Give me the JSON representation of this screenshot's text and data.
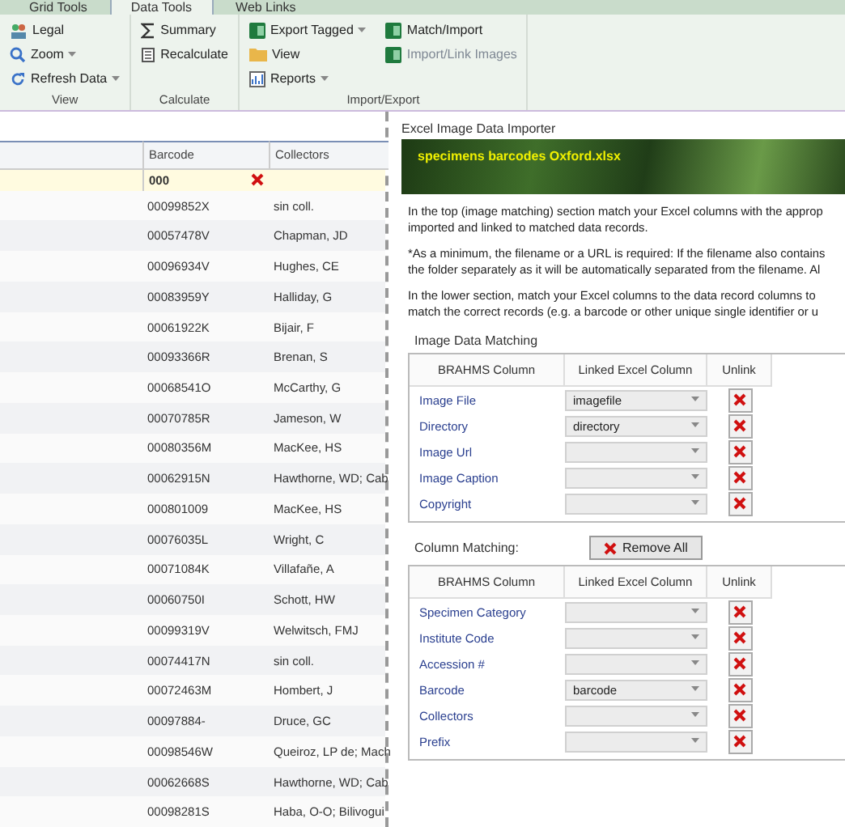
{
  "ribbon": {
    "tabs": [
      {
        "label": "Grid Tools",
        "selected": false
      },
      {
        "label": "Data Tools",
        "selected": true
      },
      {
        "label": "Web Links",
        "selected": false
      }
    ],
    "groups": [
      {
        "label": "View",
        "items": [
          {
            "label": "Legal",
            "has_menu": false,
            "disabled": false
          },
          {
            "label": "Zoom",
            "has_menu": true,
            "disabled": false
          },
          {
            "label": "Refresh Data",
            "has_menu": true,
            "disabled": false
          }
        ]
      },
      {
        "label": "Calculate",
        "items": [
          {
            "label": "Summary",
            "has_menu": false,
            "disabled": false
          },
          {
            "label": "Recalculate",
            "has_menu": false,
            "disabled": false
          }
        ]
      },
      {
        "label": "Import/Export",
        "items": [
          {
            "label": "Export Tagged",
            "has_menu": true,
            "disabled": false
          },
          {
            "label": "View",
            "has_menu": false,
            "disabled": false
          },
          {
            "label": "Reports",
            "has_menu": true,
            "disabled": false
          },
          {
            "label": "Match/Import",
            "has_menu": false,
            "disabled": false
          },
          {
            "label": "Import/Link Images",
            "has_menu": false,
            "disabled": true
          }
        ]
      }
    ]
  },
  "grid": {
    "columns": [
      "Barcode",
      "Collectors"
    ],
    "filter": "000",
    "rows": [
      {
        "barcode": "00099852X",
        "collectors": "sin coll."
      },
      {
        "barcode": "00057478V",
        "collectors": "Chapman, JD"
      },
      {
        "barcode": "00096934V",
        "collectors": "Hughes, CE"
      },
      {
        "barcode": "00083959Y",
        "collectors": "Halliday, G"
      },
      {
        "barcode": "00061922K",
        "collectors": "Bijair, F"
      },
      {
        "barcode": "00093366R",
        "collectors": "Brenan, S"
      },
      {
        "barcode": "00068541O",
        "collectors": "McCarthy, G"
      },
      {
        "barcode": "00070785R",
        "collectors": "Jameson, W"
      },
      {
        "barcode": "00080356M",
        "collectors": "MacKee, HS"
      },
      {
        "barcode": "00062915N",
        "collectors": "Hawthorne, WD; Cab"
      },
      {
        "barcode": "000801009",
        "collectors": "MacKee, HS"
      },
      {
        "barcode": "00076035L",
        "collectors": "Wright, C"
      },
      {
        "barcode": "00071084K",
        "collectors": "Villafañe, A"
      },
      {
        "barcode": "00060750I",
        "collectors": "Schott, HW"
      },
      {
        "barcode": "00099319V",
        "collectors": "Welwitsch, FMJ"
      },
      {
        "barcode": "00074417N",
        "collectors": "sin coll."
      },
      {
        "barcode": "00072463M",
        "collectors": "Hombert, J"
      },
      {
        "barcode": "00097884-",
        "collectors": "Druce, GC"
      },
      {
        "barcode": "00098546W",
        "collectors": "Queiroz, LP de; Mach"
      },
      {
        "barcode": "00062668S",
        "collectors": "Hawthorne, WD; Cab"
      },
      {
        "barcode": "00098281S",
        "collectors": "Haba, O-O; Bilivogui"
      }
    ]
  },
  "importer": {
    "title": "Excel Image Data Importer",
    "file": "specimens barcodes Oxford.xlsx",
    "paragraphs": [
      "In the top (image matching) section match your Excel columns with the approp imported and linked to matched data records.",
      "*As a minimum, the filename or a URL is required: If the filename also contains the folder separately as it will be automatically separated from the filename. Al",
      "In the lower section, match your Excel columns to the data record columns to match the correct records (e.g. a barcode or other unique single identifier or u"
    ],
    "image_section": {
      "title": "Image Data Matching",
      "columns": [
        "BRAHMS Column",
        "Linked Excel Column",
        "Unlink"
      ],
      "rows": [
        {
          "label": "Image File",
          "value": "imagefile"
        },
        {
          "label": "Directory",
          "value": "directory"
        },
        {
          "label": "Image Url",
          "value": ""
        },
        {
          "label": "Image Caption",
          "value": ""
        },
        {
          "label": "Copyright",
          "value": ""
        }
      ]
    },
    "column_section": {
      "title": "Column Matching:",
      "button": "Remove All",
      "columns": [
        "BRAHMS Column",
        "Linked Excel Column",
        "Unlink"
      ],
      "rows": [
        {
          "label": "Specimen Category",
          "value": ""
        },
        {
          "label": "Institute Code",
          "value": ""
        },
        {
          "label": "Accession #",
          "value": ""
        },
        {
          "label": "Barcode",
          "value": "barcode"
        },
        {
          "label": "Collectors",
          "value": ""
        },
        {
          "label": "Prefix",
          "value": ""
        }
      ]
    }
  }
}
